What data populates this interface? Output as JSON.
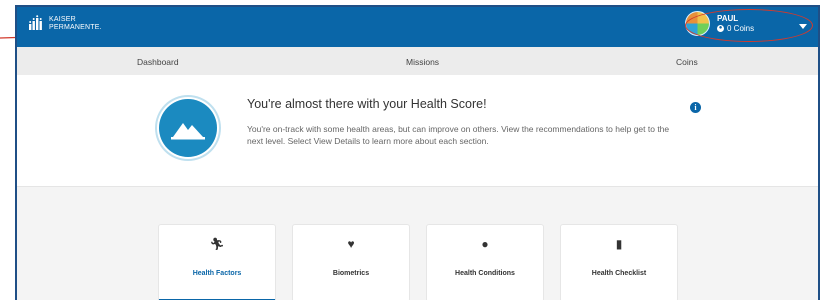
{
  "header": {
    "brand_line1": "KAISER",
    "brand_line2": "PERMANENTE.",
    "user_name": "PAUL",
    "coins": "0 Coins"
  },
  "nav": {
    "tabs": [
      {
        "label": "Dashboard"
      },
      {
        "label": "Missions"
      },
      {
        "label": "Coins"
      }
    ]
  },
  "score_card": {
    "headline": "You're almost there with your Health Score!",
    "description": "You're on-track with some health areas, but can improve on others. View the recommendations to help get to the next level. Select View Details to learn more about each section."
  },
  "tiles": [
    {
      "label": "Health Factors",
      "icon": "running-person-icon",
      "active": true
    },
    {
      "label": "Biometrics",
      "icon": "heart-rate-icon",
      "active": false
    },
    {
      "label": "Health Conditions",
      "icon": "alert-circle-icon",
      "active": false
    },
    {
      "label": "Health Checklist",
      "icon": "clipboard-icon",
      "active": false
    }
  ],
  "colors": {
    "brand_blue": "#0a66a8",
    "callout_red": "#d23a2d"
  }
}
